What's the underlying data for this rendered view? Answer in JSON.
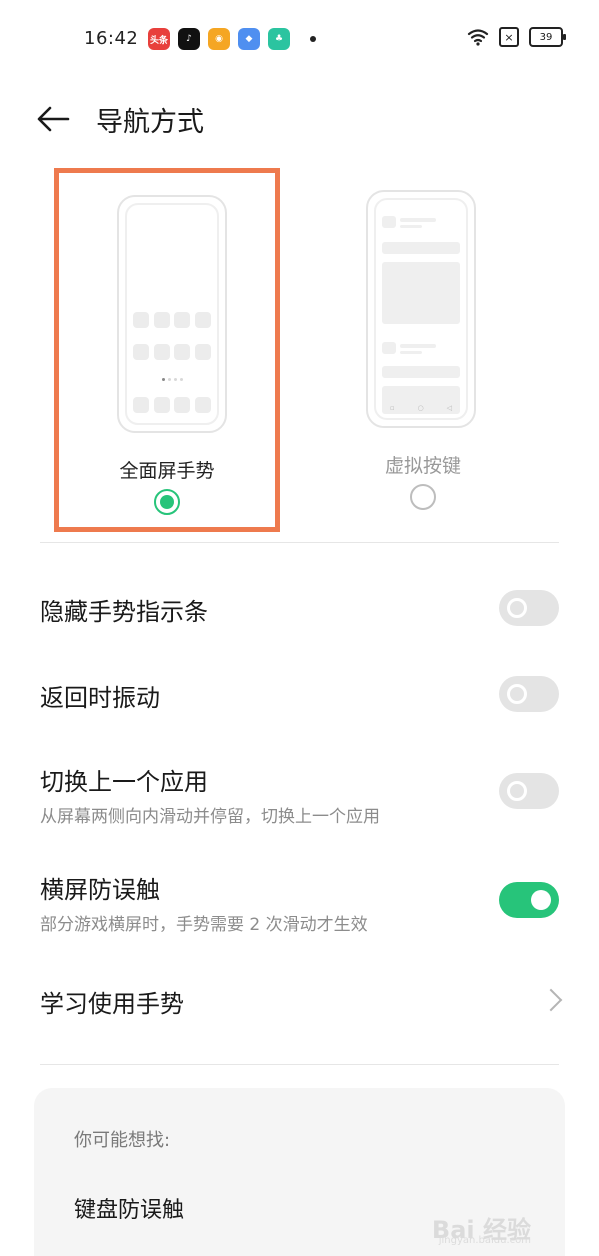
{
  "status_bar": {
    "time": "16:42",
    "apps": [
      {
        "icon": "toutiao-icon",
        "text": "头条",
        "color": "#e8403c"
      },
      {
        "icon": "tiktok-icon",
        "text": "♪",
        "color": "#111111"
      },
      {
        "icon": "weibo-icon",
        "text": "◉",
        "color": "#f5a623"
      },
      {
        "icon": "chat-icon",
        "text": "◆",
        "color": "#4f8ff0"
      },
      {
        "icon": "app-icon",
        "text": "♣",
        "color": "#2bc4a0"
      }
    ],
    "battery": "39",
    "wifi_icon": "wifi-icon",
    "sim_icon": "no-sim-icon"
  },
  "header": {
    "back_icon": "arrow-left-icon",
    "title": "导航方式"
  },
  "modes": [
    {
      "label": "全面屏手势",
      "selected": true
    },
    {
      "label": "虚拟按键",
      "selected": false
    }
  ],
  "settings": [
    {
      "label": "隐藏手势指示条",
      "toggle": false
    },
    {
      "label": "返回时振动",
      "toggle": false
    },
    {
      "label": "切换上一个应用",
      "sub": "从屏幕两侧向内滑动并停留，切换上一个应用",
      "toggle": false
    },
    {
      "label": "横屏防误触",
      "sub": "部分游戏横屏时，手势需要 2 次滑动才生效",
      "toggle": true
    },
    {
      "label": "学习使用手势",
      "chevron_icon": "chevron-right-icon"
    }
  ],
  "suggestions": {
    "title": "你可能想找:",
    "items": [
      "键盘防误触"
    ]
  },
  "watermark": {
    "text": "Bai 经验",
    "url": "jingyan.baidu.com"
  },
  "colors": {
    "accent": "#27c47a",
    "highlight_border": "#ee7a4e"
  }
}
